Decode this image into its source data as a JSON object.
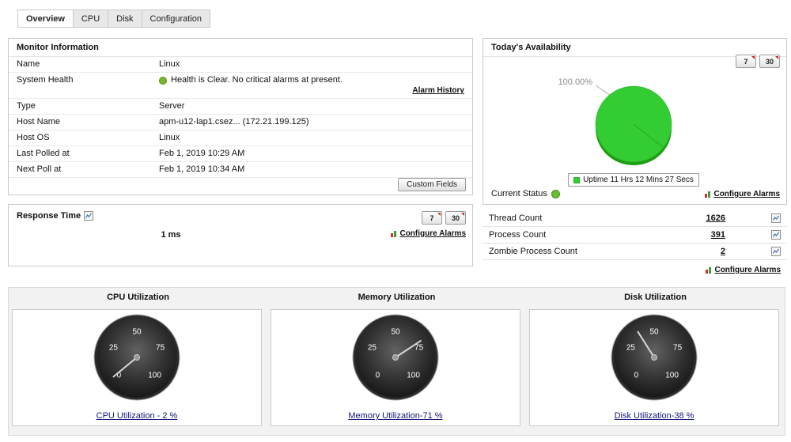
{
  "tabs": [
    {
      "label": "Overview",
      "active": true
    },
    {
      "label": "CPU",
      "active": false
    },
    {
      "label": "Disk",
      "active": false
    },
    {
      "label": "Configuration",
      "active": false
    }
  ],
  "monitor_info": {
    "title": "Monitor Information",
    "rows": [
      {
        "label": "Name",
        "value": "Linux"
      },
      {
        "label": "System Health",
        "value": "Health is Clear. No critical alarms at present."
      },
      {
        "label": "Type",
        "value": "Server"
      },
      {
        "label": "Host Name",
        "value": "apm-u12-lap1.csez... (172.21.199.125)"
      },
      {
        "label": "Host OS",
        "value": "Linux"
      },
      {
        "label": "Last Polled at",
        "value": "Feb 1, 2019 10:29 AM"
      },
      {
        "label": "Next Poll at",
        "value": "Feb 1, 2019 10:34 AM"
      }
    ],
    "alarm_history_link": "Alarm History",
    "custom_fields_button": "Custom Fields"
  },
  "response_time": {
    "title": "Response Time",
    "value": "1 ms",
    "configure_alarms": "Configure Alarms"
  },
  "availability": {
    "title": "Today's Availability",
    "current_status_label": "Current Status",
    "configure_alarms": "Configure Alarms"
  },
  "period_buttons": {
    "seven": "7",
    "thirty": "30"
  },
  "stats": {
    "rows": [
      {
        "label": "Thread Count",
        "value": "1626"
      },
      {
        "label": "Process Count",
        "value": "391"
      },
      {
        "label": "Zombie Process Count",
        "value": "2"
      }
    ],
    "configure_alarms": "Configure Alarms"
  },
  "chart_data": [
    {
      "type": "pie",
      "title": "Today's Availability",
      "data_label": "100.00%",
      "slices": [
        {
          "label": "Uptime 11 Hrs 12 Mins 27 Secs",
          "value": 100,
          "color": "#33cc33"
        }
      ],
      "legend_position": "bottom"
    },
    {
      "type": "gauge",
      "title": "CPU Utilization",
      "caption": "CPU Utilization - 2 %",
      "value": 2,
      "min": 0,
      "max": 100,
      "ticks": [
        0,
        25,
        50,
        75,
        100
      ]
    },
    {
      "type": "gauge",
      "title": "Memory Utilization",
      "caption": "Memory Utilization-71 %",
      "value": 71,
      "min": 0,
      "max": 100,
      "ticks": [
        0,
        25,
        50,
        75,
        100
      ]
    },
    {
      "type": "gauge",
      "title": "Disk Utilization",
      "caption": "Disk Utilization-38 %",
      "value": 38,
      "min": 0,
      "max": 100,
      "ticks": [
        0,
        25,
        50,
        75,
        100
      ]
    }
  ],
  "icons": {
    "configure_alarms": "alarm-bars-icon",
    "period_button_corner": "red-corner-marker",
    "stat_graph": "chart-box-icon",
    "health": "green-dot",
    "status": "green-dot"
  },
  "colors": {
    "health_green": "#76b82a",
    "status_green": "#6abf2e",
    "pie_green": "#33cc33",
    "alarm_icon_red": "#d22f2f",
    "alarm_icon_green": "#3a9e3a",
    "gauge_caption_blue": "#15157b"
  }
}
